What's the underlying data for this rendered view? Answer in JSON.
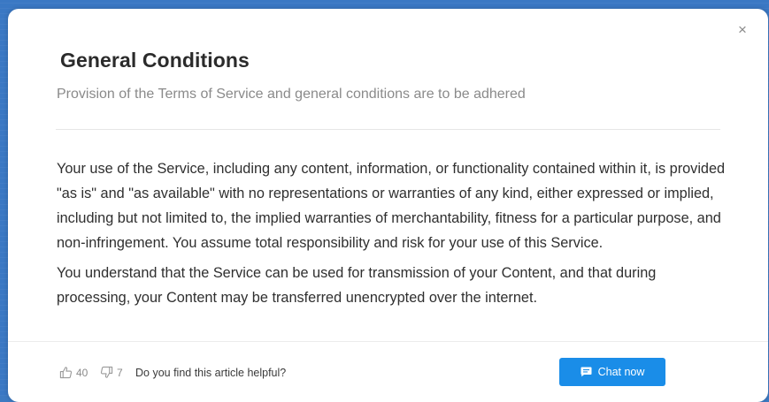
{
  "modal": {
    "close_glyph": "×",
    "title": "General Conditions",
    "subtitle": "Provision of the Terms of Service and general conditions are to be adhered",
    "paragraphs": [
      "Your use of the Service, including any content, information, or functionality contained within it, is provided \"as is\" and \"as available\" with no representations or warranties of any kind, either expressed or implied, including but not limited to, the implied warranties of merchantability, fitness for a particular purpose, and non-infringement. You assume total responsibility and risk for your use of this Service.",
      "You understand that the Service can be used for transmission of your Content, and that during processing, your Content may be transferred unencrypted over the internet."
    ]
  },
  "footer": {
    "upvotes": "40",
    "downvotes": "7",
    "helpful_prompt": "Do you find this article helpful?",
    "chat_label": "Chat now"
  },
  "icons": {
    "close": "close-icon",
    "thumbs_up": "thumbs-up-icon",
    "thumbs_down": "thumbs-down-icon",
    "chat": "chat-bubble-icon"
  },
  "colors": {
    "background": "#3a78c4",
    "accent": "#1a8de8",
    "title": "#2b2b2b",
    "muted": "#8a8a8a"
  }
}
